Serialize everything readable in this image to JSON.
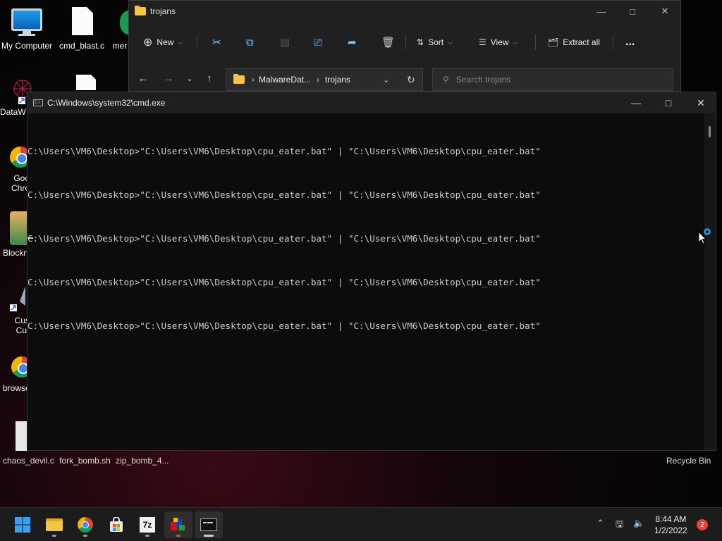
{
  "desktop": {
    "icons": [
      {
        "label": "My Computer"
      },
      {
        "label": "cmd_blast.c"
      },
      {
        "label": "mer"
      },
      {
        "label": "DataW"
      },
      {
        "label": "Goo\nChro"
      },
      {
        "label": "Blockn"
      },
      {
        "label": "Cus\nCur"
      },
      {
        "label": "browse"
      }
    ],
    "bottom_files": [
      "chaos_devil.c",
      "fork_bomb.sh",
      "zip_bomb_4..."
    ],
    "recycle_bin": "Recycle Bin"
  },
  "explorer": {
    "title": "trojans",
    "toolbar": {
      "new_label": "New",
      "sort_label": "Sort",
      "view_label": "View",
      "extract_label": "Extract all",
      "more_label": "..."
    },
    "breadcrumb": [
      "MalwareDat...",
      "trojans"
    ],
    "search_placeholder": "Search trojans"
  },
  "cmd": {
    "title": "C:\\Windows\\system32\\cmd.exe",
    "lines": [
      "C:\\Users\\VM6\\Desktop>\"C:\\Users\\VM6\\Desktop\\cpu_eater.bat\" | \"C:\\Users\\VM6\\Desktop\\cpu_eater.bat\"",
      "C:\\Users\\VM6\\Desktop>\"C:\\Users\\VM6\\Desktop\\cpu_eater.bat\" | \"C:\\Users\\VM6\\Desktop\\cpu_eater.bat\"",
      "C:\\Users\\VM6\\Desktop>\"C:\\Users\\VM6\\Desktop\\cpu_eater.bat\" | \"C:\\Users\\VM6\\Desktop\\cpu_eater.bat\"",
      "C:\\Users\\VM6\\Desktop>\"C:\\Users\\VM6\\Desktop\\cpu_eater.bat\" | \"C:\\Users\\VM6\\Desktop\\cpu_eater.bat\"",
      "C:\\Users\\VM6\\Desktop>\"C:\\Users\\VM6\\Desktop\\cpu_eater.bat\" | \"C:\\Users\\VM6\\Desktop\\cpu_eater.bat\""
    ]
  },
  "taskbar": {
    "apps": [
      "start-button",
      "file-explorer-icon",
      "chrome-icon",
      "store-icon",
      "7zip-icon",
      "app-icon",
      "terminal-icon"
    ],
    "sevenzip_label": "7z",
    "time": "8:44 AM",
    "date": "1/2/2022",
    "notification_count": "2"
  },
  "colors": {
    "accent": "#0078d4",
    "folder": "#f4c542",
    "console_text": "#cccccc",
    "console_bg": "#0c0c0c"
  }
}
